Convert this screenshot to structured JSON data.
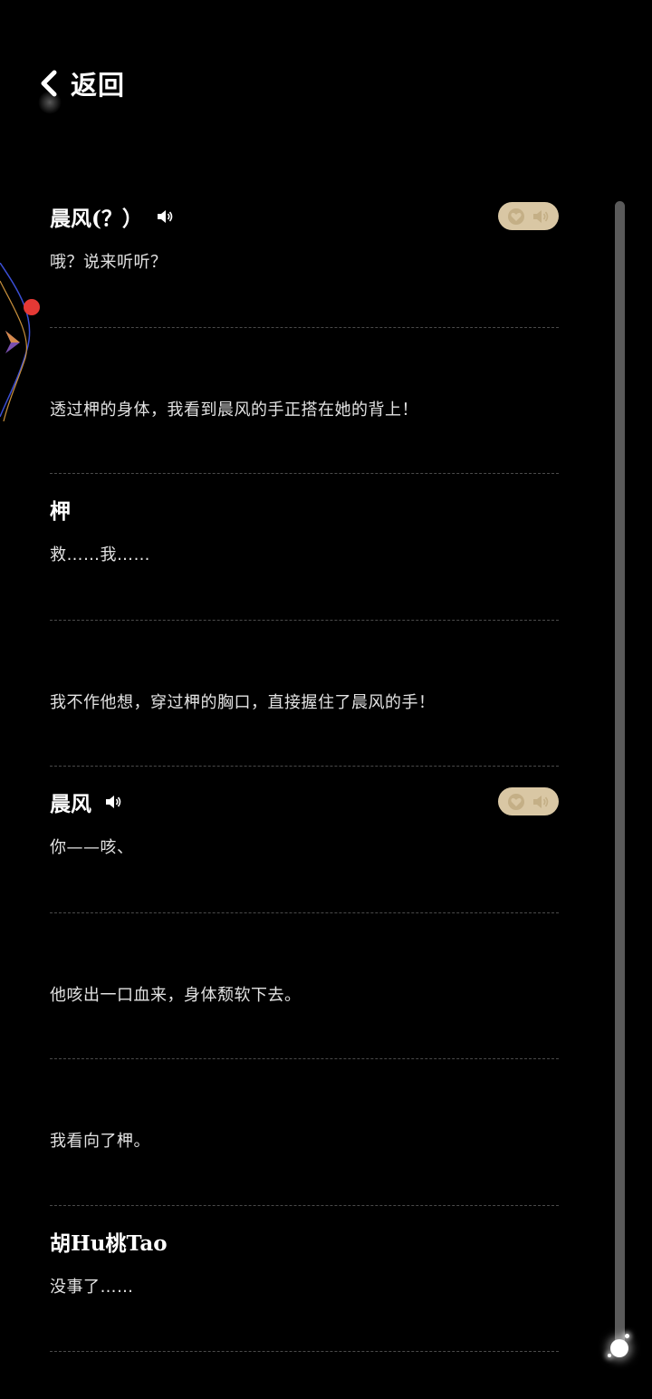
{
  "header": {
    "back_label": "返回"
  },
  "entries": [
    {
      "type": "dialogue",
      "speaker": "晨风(？）",
      "has_voice": true,
      "text": "哦？说来听听？"
    },
    {
      "type": "narration",
      "text": "透过柙的身体，我看到晨风的手正搭在她的背上！"
    },
    {
      "type": "dialogue",
      "speaker": "柙",
      "has_voice": false,
      "text": "救……我……"
    },
    {
      "type": "narration",
      "text": "我不作他想，穿过柙的胸口，直接握住了晨风的手！"
    },
    {
      "type": "dialogue",
      "speaker": "晨风",
      "has_voice": true,
      "text": "你——咳、"
    },
    {
      "type": "narration",
      "text": "他咳出一口血来，身体颓软下去。"
    },
    {
      "type": "narration",
      "text": "我看向了柙。"
    },
    {
      "type": "dialogue",
      "speaker": "胡Hu桃Tao",
      "has_voice": false,
      "text": "没事了……"
    }
  ],
  "colors": {
    "background": "#000000",
    "toggle": "#d9c7a4",
    "toggle_icon": "#c4af86",
    "scrollbar": "#5a5a5a",
    "accent_dot": "#e53935"
  },
  "icons": {
    "back": "chevron-left-icon",
    "speaker": "speaker-icon",
    "favorite": "heart-icon",
    "voice": "voice-play-icon"
  },
  "scroll": {
    "position": 1.0
  }
}
